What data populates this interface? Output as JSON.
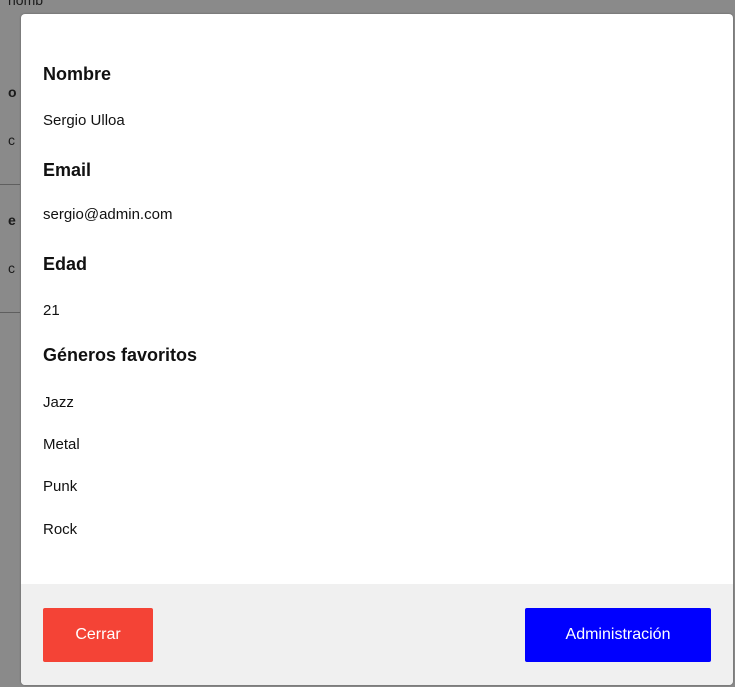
{
  "colors": {
    "close_button": "#f44336",
    "admin_button": "#0000ff",
    "footer_bg": "#f0f0f0",
    "overlay": "#8a8a8a"
  },
  "background": {
    "fragments": [
      "nomb",
      "o",
      "c",
      "e",
      "c"
    ]
  },
  "modal": {
    "fields": [
      {
        "label": "Nombre",
        "value": "Sergio Ulloa"
      },
      {
        "label": "Email",
        "value": "sergio@admin.com"
      },
      {
        "label": "Edad",
        "value": "21"
      }
    ],
    "genres_label": "Géneros favoritos",
    "genres": [
      "Jazz",
      "Metal",
      "Punk",
      "Rock"
    ]
  },
  "footer": {
    "close_label": "Cerrar",
    "admin_label": "Administración"
  }
}
